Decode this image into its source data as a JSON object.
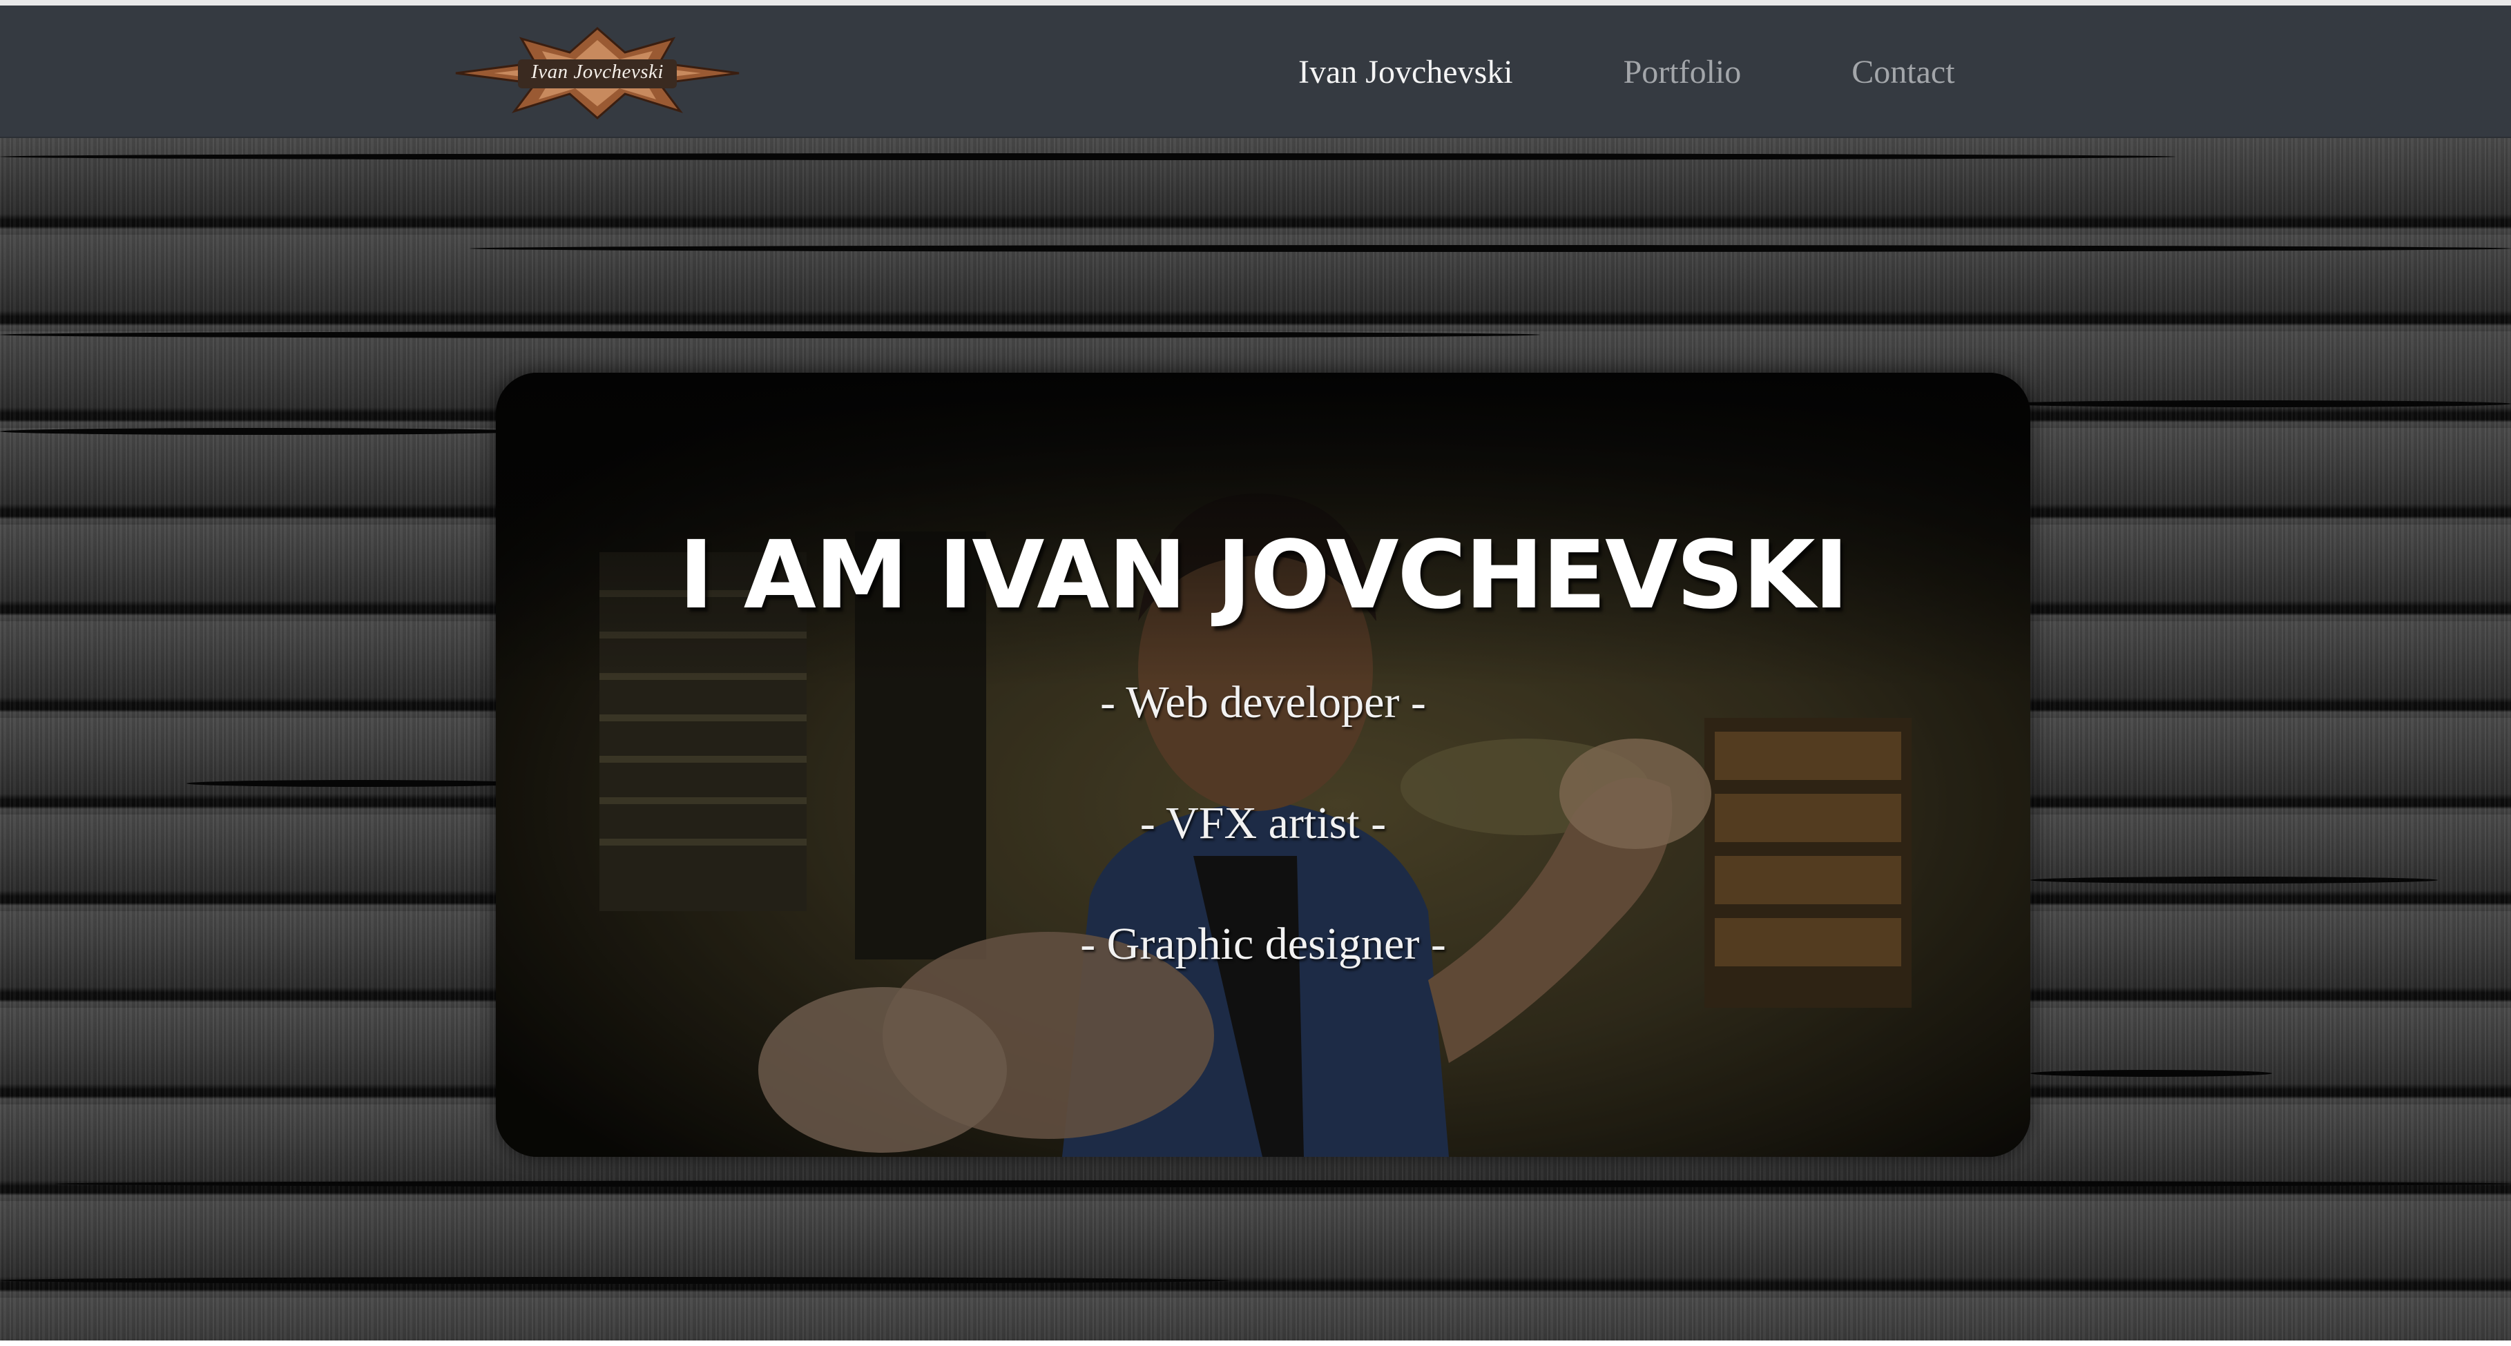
{
  "navbar": {
    "logo_text": "Ivan Jovchevski",
    "links": [
      {
        "label": "Ivan Jovchevski",
        "active": true
      },
      {
        "label": "Portfolio",
        "active": false
      },
      {
        "label": "Contact",
        "active": false
      }
    ]
  },
  "hero": {
    "title": "I AM IVAN JOVCHEVSKI",
    "roles": [
      "- Web developer -",
      "- VFX artist -",
      "- Graphic designer -"
    ]
  },
  "colors": {
    "navbar_bg": "#353a41",
    "nav_active": "#f4f4f4",
    "nav_inactive": "#a3a6aa",
    "logo_accent": "#b8784e"
  }
}
